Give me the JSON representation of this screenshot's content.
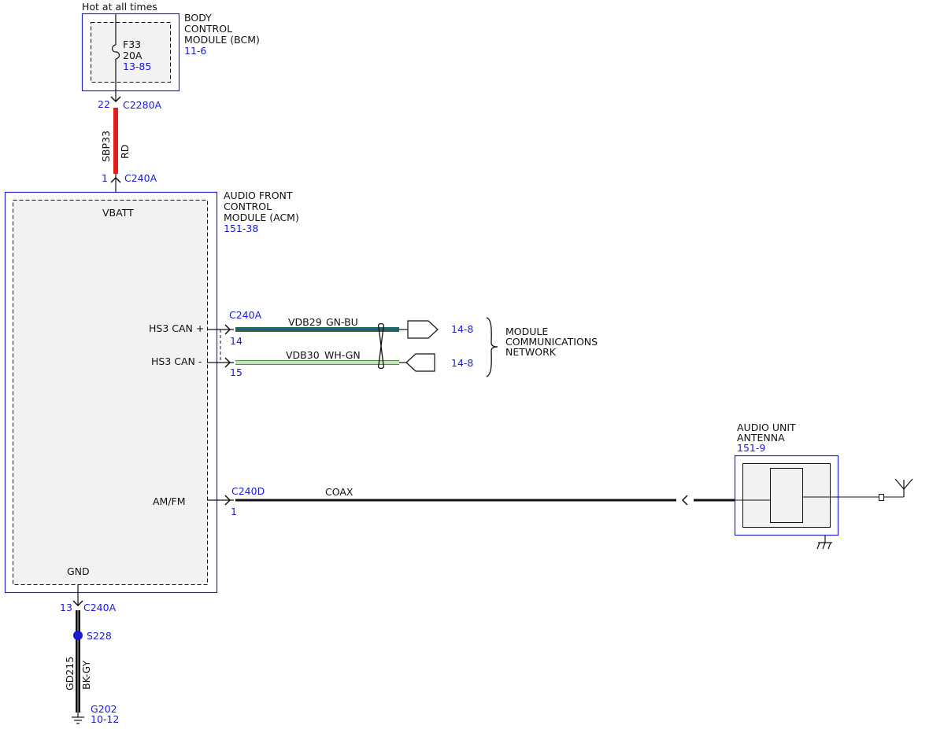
{
  "colors": {
    "ref": "#1a1ad6",
    "line": "#111111",
    "box": "#2424d0",
    "fill": "#f2f2f2",
    "red_wire": "#e01e1e",
    "gn_bu_wire": "#1f6b4a",
    "wh_gn_wire": "#9bd48a",
    "splice": "#1a1ad6"
  },
  "power": {
    "label": "Hot at all times"
  },
  "bcm": {
    "name_lines": [
      "BODY",
      "CONTROL",
      "MODULE (BCM)"
    ],
    "ref": "11-6",
    "fuse": {
      "name": "F33",
      "rating": "20A",
      "ref": "13-85"
    }
  },
  "wire_feed": {
    "connector": "C2280A",
    "pin": "22",
    "circuit": "SBP33",
    "color": "RD"
  },
  "acm": {
    "name_lines": [
      "AUDIO FRONT",
      "CONTROL",
      "MODULE (ACM)"
    ],
    "ref": "151-38",
    "vbatt_connector": "C240A",
    "vbatt_pin": "1",
    "pins": {
      "vbatt": "VBATT",
      "hs3_plus": "HS3 CAN +",
      "hs3_minus": "HS3 CAN -",
      "amfm": "AM/FM",
      "gnd": "GND"
    }
  },
  "can_bus": {
    "connector": "C240A",
    "plus_pin": "14",
    "minus_pin": "15",
    "plus_circuit": "VDB29",
    "plus_color": "GN-BU",
    "minus_circuit": "VDB30",
    "minus_color": "WH-GN",
    "plus_ref": "14-8",
    "minus_ref": "14-8",
    "network_lines": [
      "MODULE",
      "COMMUNICATIONS",
      "NETWORK"
    ]
  },
  "coax": {
    "connector": "C240D",
    "pin": "1",
    "label": "COAX"
  },
  "antenna": {
    "name_lines": [
      "AUDIO UNIT",
      "ANTENNA"
    ],
    "ref": "151-9"
  },
  "ground": {
    "connector": "C240A",
    "pin": "13",
    "splice": "S228",
    "circuit": "GD215",
    "color": "BK-GY",
    "point": "G202",
    "ref": "10-12"
  }
}
